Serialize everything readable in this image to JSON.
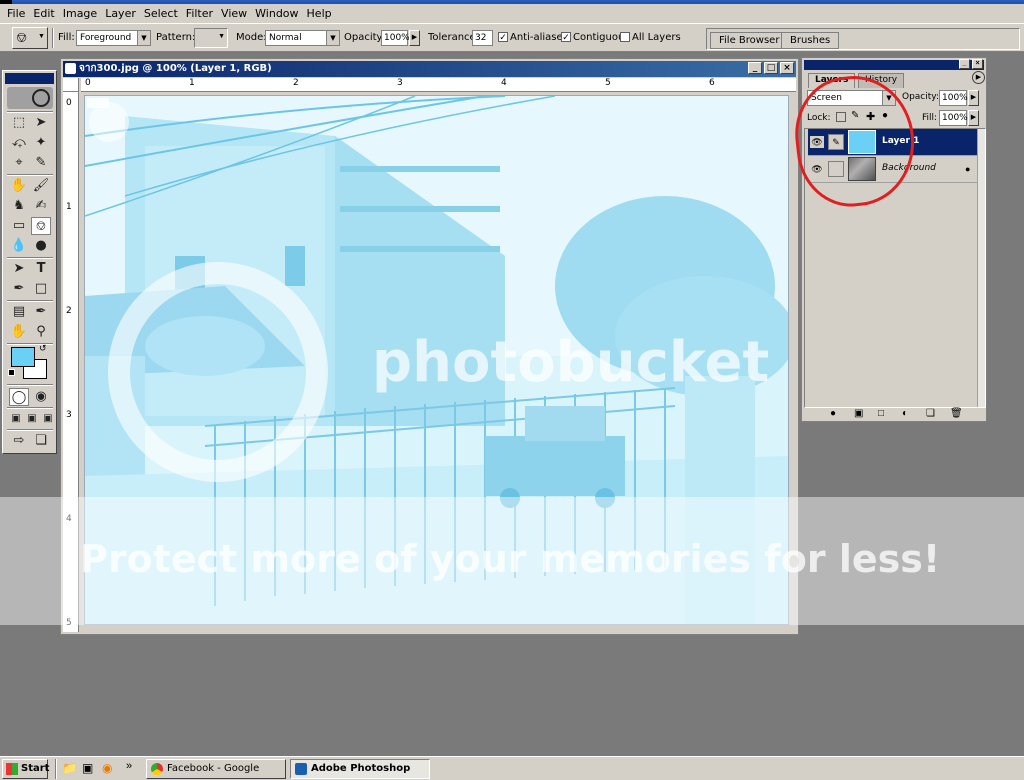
{
  "menubar": {
    "items": [
      "File",
      "Edit",
      "Image",
      "Layer",
      "Select",
      "Filter",
      "View",
      "Window",
      "Help"
    ]
  },
  "options": {
    "fill_label": "Fill:",
    "fill_value": "Foreground",
    "pattern_label": "Pattern:",
    "mode_label": "Mode:",
    "mode_value": "Normal",
    "opacity_label": "Opacity:",
    "opacity_value": "100%",
    "tolerance_label": "Tolerance:",
    "tolerance_value": "32",
    "anti_aliased": "Anti-aliased",
    "contiguous": "Contiguous",
    "all_layers": "All Layers",
    "file_browser": "File Browser",
    "brushes": "Brushes"
  },
  "document": {
    "title": "จาก300.jpg @ 100% (Layer 1, RGB)",
    "ruler_top": [
      "0",
      "1",
      "2",
      "3",
      "4",
      "5",
      "6"
    ],
    "ruler_left": [
      "0",
      "1",
      "2",
      "3",
      "4",
      "5"
    ]
  },
  "layers_panel": {
    "tab_layers": "Layers",
    "tab_history": "History",
    "blend_mode": "Screen",
    "opacity_label": "Opacity:",
    "opacity_value": "100%",
    "lock_label": "Lock:",
    "fill_label": "Fill:",
    "fill_value": "100%",
    "layers": [
      {
        "name": "Layer 1",
        "selected": true
      },
      {
        "name": "Background",
        "selected": false
      }
    ]
  },
  "watermark": {
    "logo": "photobucket",
    "tagline": "Protect more of your memories for less!"
  },
  "taskbar": {
    "start": "Start",
    "more": "»",
    "tasks": [
      "Facebook - Google Chrome",
      "Adobe Photoshop"
    ]
  },
  "colors": {
    "foreground": "#6ad0f5",
    "background": "#ffffff",
    "selection": "#0a246a",
    "annotation": "#e02020"
  }
}
